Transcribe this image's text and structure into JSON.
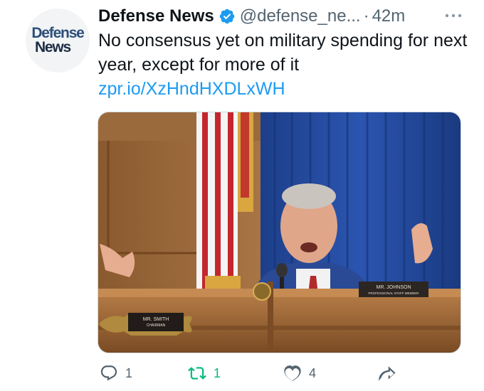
{
  "account": {
    "avatar_line1": "Defense",
    "avatar_line2": "News",
    "name": "Defense News",
    "handle": "@defense_ne...",
    "separator": "·",
    "time": "42m"
  },
  "tweet": {
    "text": "No consensus yet on military spending for next year, except for more of it",
    "link": "zpr.io/XzHndHXDLxWH"
  },
  "media": {
    "nameplate_left_line1": "MR. SMITH",
    "nameplate_left_line2": "CHAIRMAN",
    "nameplate_right_line1": "MR. JOHNSON",
    "nameplate_right_line2": "PROFESSIONAL STAFF MEMBER"
  },
  "actions": {
    "reply_count": "1",
    "retweet_count": "1",
    "like_count": "4"
  },
  "colors": {
    "link": "#1d9bf0",
    "verified": "#1d9bf0",
    "retweet_active": "#00ba7c",
    "secondary_text": "#536471"
  },
  "icons": [
    "verified-badge-icon",
    "more-icon",
    "reply-icon",
    "retweet-icon",
    "like-icon",
    "share-icon"
  ]
}
